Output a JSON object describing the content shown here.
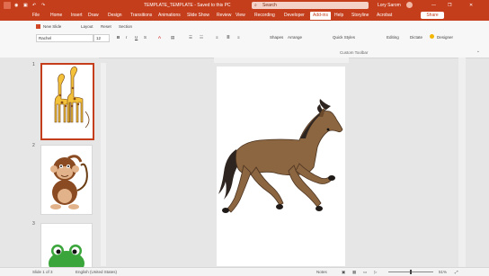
{
  "titlebar": {
    "file_name": "TEMPLATE_TEMPLATE - Saved to this PC",
    "search_placeholder": "Search",
    "user": "Lory Sarom"
  },
  "tabs": [
    "File",
    "Home",
    "Insert",
    "Draw",
    "Design",
    "Transitions",
    "Animations",
    "Slide Show",
    "Review",
    "View",
    "Recording",
    "Developer",
    "Add-ins",
    "Help",
    "Storyline",
    "Acrobat"
  ],
  "share_label": "Share",
  "ribbon": {
    "font_name": "Rachel",
    "font_size": "12",
    "new_slide": "New Slide",
    "layout": "Layout",
    "reset": "Reset",
    "section": "Section",
    "shapes": "Shapes",
    "arrange": "Arrange",
    "quick_styles": "Quick Styles",
    "editing": "Editing",
    "dictate": "Dictate",
    "designer": "Designer",
    "group_label": "Custom Toolbar"
  },
  "thumbnails": [
    {
      "num": "1",
      "subject": "giraffes"
    },
    {
      "num": "2",
      "subject": "monkey"
    },
    {
      "num": "3",
      "subject": "frog"
    }
  ],
  "statusbar": {
    "slide_info": "Slide 1 of 3",
    "language": "English (United States)",
    "notes": "Notes",
    "zoom": "51%"
  }
}
